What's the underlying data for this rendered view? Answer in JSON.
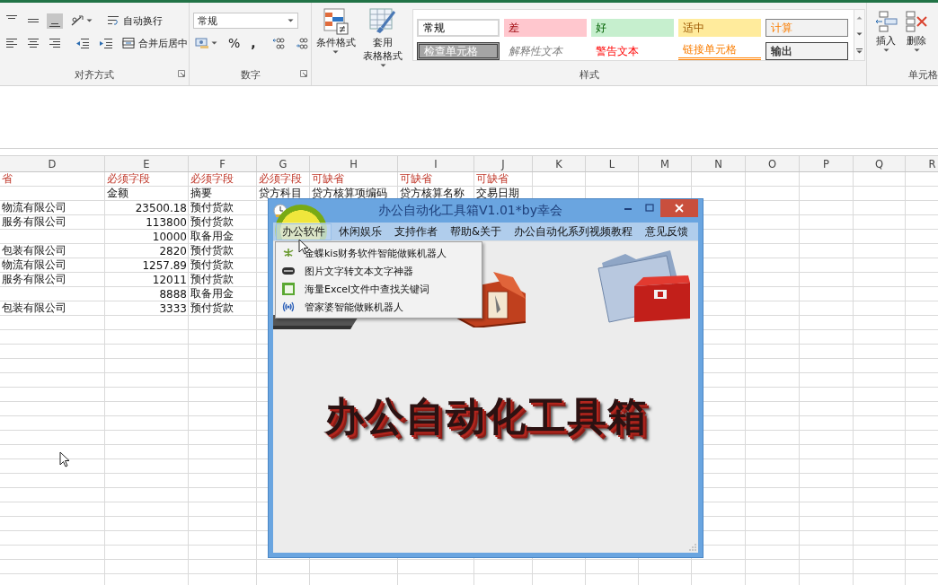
{
  "ribbon": {
    "alignment": {
      "label": "对齐方式",
      "valign_buttons": [
        {
          "selected": false
        },
        {
          "selected": false
        },
        {
          "selected": true
        }
      ],
      "wrap_text": "自动换行",
      "merge_center": "合并后居中"
    },
    "number": {
      "label": "数字",
      "format": "常规",
      "percent": "%",
      "comma": ","
    },
    "styles": {
      "label": "样式",
      "conditional": "条件格式",
      "table_format": [
        "套用",
        "表格格式"
      ],
      "gallery": [
        {
          "text": "常规",
          "kind": "normal"
        },
        {
          "text": "差",
          "kind": "bad"
        },
        {
          "text": "好",
          "kind": "good"
        },
        {
          "text": "适中",
          "kind": "neutral"
        },
        {
          "text": "计算",
          "kind": "calc"
        },
        {
          "text": "检查单元格",
          "kind": "check"
        },
        {
          "text": "解释性文本",
          "kind": "explain"
        },
        {
          "text": "警告文本",
          "kind": "warn"
        },
        {
          "text": "链接单元格",
          "kind": "linked"
        },
        {
          "text": "输出",
          "kind": "output"
        }
      ]
    },
    "cells": {
      "label": "单元格",
      "insert": "插入",
      "delete": "删除"
    }
  },
  "sheet": {
    "columns": [
      "D",
      "E",
      "F",
      "G",
      "H",
      "I",
      "J",
      "K",
      "L",
      "M",
      "N",
      "O",
      "P",
      "Q",
      "R"
    ],
    "rows": [
      {
        "kind": "hint",
        "cells": [
          "省",
          "必须字段",
          "必须字段",
          "必须字段",
          "可缺省",
          "可缺省",
          "可缺省"
        ]
      },
      {
        "kind": "data",
        "cells": [
          "",
          "金额",
          "摘要",
          "贷方科目",
          "贷方核算项编码",
          "贷方核算名称",
          "交易日期"
        ]
      },
      {
        "kind": "data",
        "cells": [
          "物流有限公司",
          "23500.18",
          "预付货款"
        ]
      },
      {
        "kind": "data",
        "cells": [
          "服务有限公司",
          "113800",
          "预付货款"
        ]
      },
      {
        "kind": "data",
        "cells": [
          "",
          "10000",
          "取备用金"
        ]
      },
      {
        "kind": "data",
        "cells": [
          "包装有限公司",
          "2820",
          "预付货款"
        ]
      },
      {
        "kind": "data",
        "cells": [
          "物流有限公司",
          "1257.89",
          "预付货款"
        ]
      },
      {
        "kind": "data",
        "cells": [
          "服务有限公司",
          "12011",
          "预付货款"
        ]
      },
      {
        "kind": "data",
        "cells": [
          "",
          "8888",
          "取备用金"
        ]
      },
      {
        "kind": "data",
        "cells": [
          "包装有限公司",
          "3333",
          "预付货款"
        ]
      }
    ]
  },
  "dialog": {
    "title": "办公自动化工具箱V1.01*by幸会",
    "menu": [
      {
        "label": "办公软件",
        "selected": true
      },
      {
        "label": "休闲娱乐",
        "selected": false
      },
      {
        "label": "支持作者",
        "selected": false
      },
      {
        "label": "帮助&关于",
        "selected": false
      },
      {
        "label": "办公自动化系列视频教程",
        "selected": false
      },
      {
        "label": "意见反馈",
        "selected": false
      }
    ],
    "dropdown": [
      {
        "label": "金蝶kis财务软件智能做账机器人",
        "kind": "butterfly"
      },
      {
        "label": "图片文字转文本文字神器",
        "kind": "scanner"
      },
      {
        "label": "海量Excel文件中查找关键词",
        "kind": "sheet"
      },
      {
        "label": "管家婆智能做账机器人",
        "kind": "signal"
      }
    ],
    "banner": "办公自动化工具箱"
  }
}
